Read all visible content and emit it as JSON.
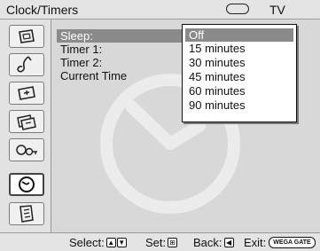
{
  "header": {
    "title": "Clock/Timers",
    "source": "TV"
  },
  "sidebar": {
    "items": [
      {
        "icon": "picture-icon"
      },
      {
        "icon": "sound-icon"
      },
      {
        "icon": "screen-icon"
      },
      {
        "icon": "channel-icon"
      },
      {
        "icon": "parental-lock-icon"
      },
      {
        "icon": "clock-icon",
        "active": true
      },
      {
        "icon": "setup-icon"
      }
    ]
  },
  "menu": {
    "rows": [
      {
        "label": "Sleep:",
        "selected": true
      },
      {
        "label": "Timer 1:",
        "value": "("
      },
      {
        "label": "Timer 2:",
        "value": "("
      },
      {
        "label": "Current Time"
      }
    ]
  },
  "dropdown": {
    "options": [
      "Off",
      "15 minutes",
      "30 minutes",
      "45 minutes",
      "60 minutes",
      "90 minutes"
    ],
    "selected": "Off"
  },
  "footer": {
    "select_label": "Select:",
    "set_label": "Set:",
    "back_label": "Back:",
    "exit_label": "Exit:",
    "exit_button": "WEGA GATE"
  }
}
